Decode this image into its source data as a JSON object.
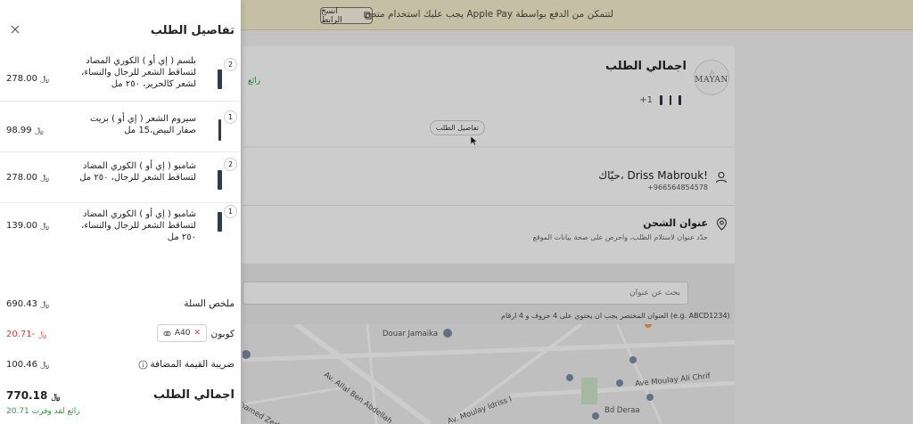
{
  "banner": {
    "text": "لتتمكن من الدفع بواسطة Apple Pay يجب عليك استخدام متصفح سفاري",
    "copy_label": "انسخ الرابط"
  },
  "background": {
    "store_logo_top": "دار",
    "store_logo_name": "MAYAN",
    "order_summary_title": "اجمالي الطلب",
    "thumbs_more": "+1",
    "green_edge_text": "رائع",
    "details_pill": "تفاصيل الطلب",
    "user_greeting": "حيّاك، Driss Mabrouk!",
    "user_phone": "+966564854578",
    "shipping_title": "عنوان الشحن",
    "shipping_desc": "حدّد عنوان لاستلام الطلب، واحرص على صحة بيانات الموقع",
    "address_search_placeholder": "بحث عن عنوان",
    "short_address_hint": "العنوان المختصر يجب ان يحتوي على 4 حروف و 4 ارقام (e.g. ABCD1234)",
    "map_labels": [
      "Douar Jamaika",
      "Av. Allal Ben Abdellah",
      "Ave Moulay Ali Chrif",
      "Bd Deraa",
      "Av. Moulay Idriss I",
      "hamed Zerktouni"
    ]
  },
  "drawer": {
    "title": "تفاصيل الطلب",
    "currency_symbol": "﷼",
    "items": [
      {
        "qty": "2",
        "name": "بلسم ( إي أو ) الكوري المضاد لتساقط الشعر للرجال والنساء، لشعر كالحرير، ٢٥٠ مل",
        "price": "278.00"
      },
      {
        "qty": "1",
        "name": "سيروم الشعر ( إي أو ) بزيت صفار البيض،15 مل",
        "price": "98.99"
      },
      {
        "qty": "2",
        "name": "شامبو ( إي أو ) الكوري المضاد لتساقط الشعر للرجال، ٢٥٠ مل",
        "price": "278.00"
      },
      {
        "qty": "1",
        "name": "شامبو ( إي أو ) الكوري المضاد لتساقط الشعر للرجال والنساء، ٢٥٠ مل",
        "price": "139.00"
      }
    ],
    "cart_summary_label": "ملخص السلة",
    "cart_summary_value": "690.43",
    "coupon_label": "كوبون",
    "coupon_code": "A40",
    "coupon_value": "-20.71",
    "vat_label": "ضريبة القيمة المضافة",
    "vat_value": "100.46",
    "total_label": "اجمالي الطلب",
    "total_value": "770.18",
    "savings_text": "رائع لقد وفرت 20.71"
  }
}
